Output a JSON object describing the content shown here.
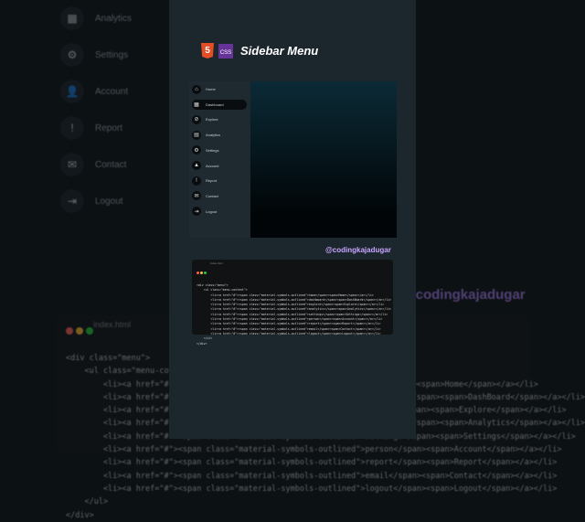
{
  "background_menu": [
    {
      "label": "Analytics",
      "icon": "analytics-icon",
      "glyph": "▦"
    },
    {
      "label": "Settings",
      "icon": "gear-icon",
      "glyph": "⚙"
    },
    {
      "label": "Account",
      "icon": "person-icon",
      "glyph": "👤"
    },
    {
      "label": "Report",
      "icon": "report-icon",
      "glyph": "!"
    },
    {
      "label": "Contact",
      "icon": "mail-icon",
      "glyph": "✉"
    },
    {
      "label": "Logout",
      "icon": "logout-icon",
      "glyph": "⇥"
    }
  ],
  "title": {
    "html_badge": "5",
    "css_badge": "CSS",
    "text": "Sidebar Menu"
  },
  "demo_menu": [
    {
      "label": "Home",
      "icon": "home-icon",
      "glyph": "⌂"
    },
    {
      "label": "Dashboard",
      "icon": "dashboard-icon",
      "glyph": "▦",
      "active": true
    },
    {
      "label": "Explore",
      "icon": "explore-icon",
      "glyph": "⊘"
    },
    {
      "label": "Analytics",
      "icon": "analytics-icon",
      "glyph": "▤"
    },
    {
      "label": "Settings",
      "icon": "gear-icon",
      "glyph": "⚙"
    },
    {
      "label": "Account",
      "icon": "person-icon",
      "glyph": "▲"
    },
    {
      "label": "Report",
      "icon": "report-icon",
      "glyph": "!"
    },
    {
      "label": "Contact",
      "icon": "mail-icon",
      "glyph": "✉"
    },
    {
      "label": "Logout",
      "icon": "logout-icon",
      "glyph": "⇥"
    }
  ],
  "watermark": "@codingkajadugar",
  "code_window": {
    "filename": "index.html",
    "lines": [
      "<div class=\"menu\">",
      "    <ul class=\"menu-content\">",
      "        <li><a href=\"#\"><span class=\"material-symbols-outlined\">home</span><span>Home</span></a></li>",
      "        <li><a href=\"#\"><span class=\"material-symbols-outlined\">dashboard</span><span>DashBoard</span></a></li>",
      "        <li><a href=\"#\"><span class=\"material-symbols-outlined\">explore</span><span>Explore</span></a></li>",
      "        <li><a href=\"#\"><span class=\"material-symbols-outlined\">analytics</span><span>Analytics</span></a></li>",
      "        <li><a href=\"#\"><span class=\"material-symbols-outlined\">settings</span><span>Settings</span></a></li>",
      "        <li><a href=\"#\"><span class=\"material-symbols-outlined\">person</span><span>Account</span></a></li>",
      "        <li><a href=\"#\"><span class=\"material-symbols-outlined\">report</span><span>Report</span></a></li>",
      "        <li><a href=\"#\"><span class=\"material-symbols-outlined\">email</span><span>Contact</span></a></li>",
      "        <li><a href=\"#\"><span class=\"material-symbols-outlined\">logout</span><span>Logout</span></a></li>",
      "    </ul>",
      "</div>"
    ]
  }
}
